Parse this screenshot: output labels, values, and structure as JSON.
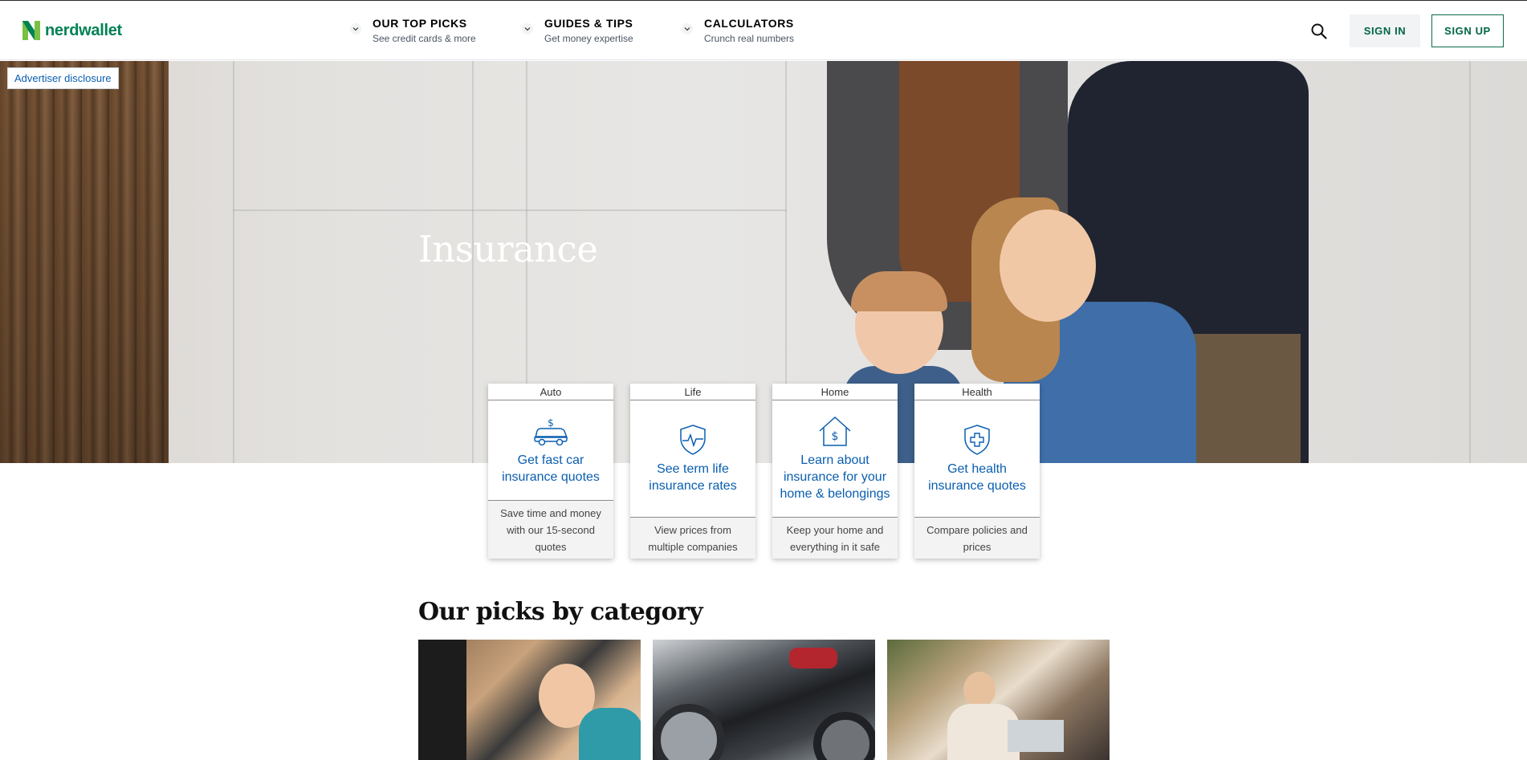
{
  "header": {
    "logo_text": "nerdwallet",
    "nav": [
      {
        "title": "OUR TOP PICKS",
        "subtitle": "See credit cards & more"
      },
      {
        "title": "GUIDES & TIPS",
        "subtitle": "Get money expertise"
      },
      {
        "title": "CALCULATORS",
        "subtitle": "Crunch real numbers"
      }
    ],
    "sign_in": "SIGN IN",
    "sign_up": "SIGN UP"
  },
  "hero": {
    "disclosure": "Advertiser disclosure",
    "title": "Insurance"
  },
  "cards": [
    {
      "label": "Auto",
      "icon": "car-dollar-icon",
      "cta": "Get fast car insurance quotes",
      "description": "Save time and money with our 15-second quotes"
    },
    {
      "label": "Life",
      "icon": "shield-heartbeat-icon",
      "cta": "See term life insurance rates",
      "description": "View prices from multiple companies"
    },
    {
      "label": "Home",
      "icon": "house-dollar-icon",
      "cta": "Learn about insurance for your home & belongings",
      "description": "Keep your home and everything in it safe"
    },
    {
      "label": "Health",
      "icon": "shield-cross-icon",
      "cta": "Get health insurance quotes",
      "description": "Compare policies and prices"
    }
  ],
  "picks": {
    "title": "Our picks by category"
  },
  "colors": {
    "brand_green": "#008254",
    "link_blue": "#0a5eb0"
  }
}
